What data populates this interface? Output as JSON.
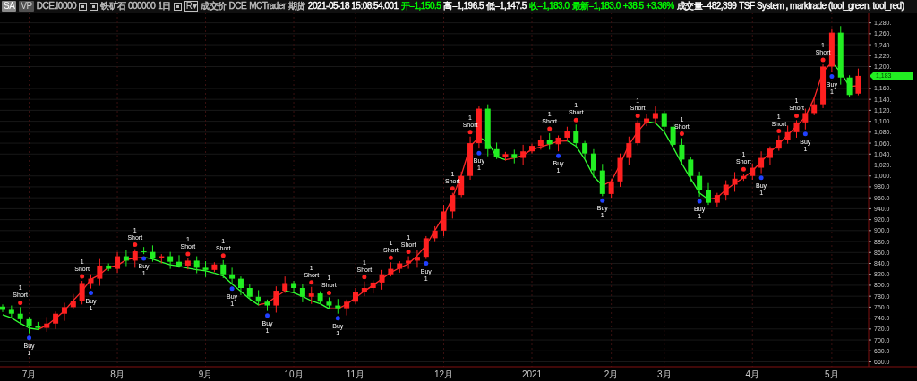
{
  "toolbar": [
    {
      "kind": "badge",
      "text": "SA",
      "selected": true
    },
    {
      "kind": "badge",
      "text": "VP",
      "selected": false
    },
    {
      "kind": "text",
      "text": "DCE.I0000",
      "color": "#c0c0c0"
    },
    {
      "kind": "square"
    },
    {
      "kind": "square"
    },
    {
      "kind": "text",
      "text": "铁矿石 000000",
      "color": "#c0c0c0"
    },
    {
      "kind": "text",
      "text": "1日",
      "color": "#c0c0c0"
    },
    {
      "kind": "square"
    },
    {
      "kind": "box",
      "text": "R▾"
    },
    {
      "kind": "text",
      "text": "成交价",
      "color": "#c0c0c0"
    },
    {
      "kind": "text",
      "text": "DCE",
      "color": "#c0c0c0"
    },
    {
      "kind": "text",
      "text": "MCTrader",
      "color": "#c0c0c0"
    },
    {
      "kind": "text",
      "text": "期货",
      "color": "#c0c0c0"
    },
    {
      "kind": "text",
      "text": "2021-05-18  15:08:54.001",
      "color": "#ffffff"
    },
    {
      "kind": "text",
      "text": "开=1,150.5",
      "color": "#00ff00"
    },
    {
      "kind": "text",
      "text": "高=1,196.5",
      "color": "#ffffff"
    },
    {
      "kind": "text",
      "text": "低=1,147.5",
      "color": "#ffffff"
    },
    {
      "kind": "text",
      "text": "收=1,183.0",
      "color": "#00ff00"
    },
    {
      "kind": "text",
      "text": "最新=1,183.0",
      "color": "#00ff00"
    },
    {
      "kind": "text",
      "text": "+38.5",
      "color": "#00ff00"
    },
    {
      "kind": "text",
      "text": "+3.36%",
      "color": "#00ff00"
    },
    {
      "kind": "text",
      "text": "成交量=482,399",
      "color": "#ffffff"
    },
    {
      "kind": "text",
      "text": "TSF System , marktrade (tool_green,  tool_red)",
      "color": "#ffffff"
    }
  ],
  "chart": {
    "price_tag": "1,183",
    "chart_data": {
      "type": "candlestick",
      "grid": true,
      "ylim": [
        651,
        1299
      ],
      "yticks": [
        {
          "value": 1280,
          "label": "1,280."
        },
        {
          "value": 1260,
          "label": "1,260."
        },
        {
          "value": 1240,
          "label": "1,240."
        },
        {
          "value": 1220,
          "label": "1,220."
        },
        {
          "value": 1200,
          "label": "1,200."
        },
        {
          "value": 1160,
          "label": "1,160."
        },
        {
          "value": 1140,
          "label": "1,140."
        },
        {
          "value": 1120,
          "label": "1,120."
        },
        {
          "value": 1100,
          "label": "1,100."
        },
        {
          "value": 1080,
          "label": "1,080."
        },
        {
          "value": 1060,
          "label": "1,060."
        },
        {
          "value": 1040,
          "label": "1,040."
        },
        {
          "value": 1020,
          "label": "1,020."
        },
        {
          "value": 1000,
          "label": "1,000."
        },
        {
          "value": 980,
          "label": "980.0"
        },
        {
          "value": 960,
          "label": "960.0"
        },
        {
          "value": 940,
          "label": "940.0"
        },
        {
          "value": 920,
          "label": "920.0"
        },
        {
          "value": 900,
          "label": "900.0"
        },
        {
          "value": 880,
          "label": "880.0"
        },
        {
          "value": 860,
          "label": "860.0"
        },
        {
          "value": 840,
          "label": "840.0"
        },
        {
          "value": 820,
          "label": "820.0"
        },
        {
          "value": 800,
          "label": "800.0"
        },
        {
          "value": 780,
          "label": "780.0"
        },
        {
          "value": 760,
          "label": "760.0"
        },
        {
          "value": 740,
          "label": "740.0"
        },
        {
          "value": 720,
          "label": "720.0"
        },
        {
          "value": 700,
          "label": "700.0"
        },
        {
          "value": 680,
          "label": "680.0"
        },
        {
          "value": 660,
          "label": "660.0"
        }
      ],
      "categories": [
        null,
        null,
        null,
        "7月",
        null,
        null,
        null,
        null,
        null,
        null,
        null,
        null,
        null,
        "8月",
        null,
        null,
        null,
        null,
        null,
        null,
        null,
        null,
        null,
        "9月",
        null,
        null,
        null,
        null,
        null,
        null,
        null,
        null,
        null,
        "10月",
        null,
        null,
        null,
        null,
        null,
        null,
        "11月",
        null,
        null,
        null,
        null,
        null,
        null,
        null,
        null,
        null,
        "12月",
        null,
        null,
        null,
        null,
        null,
        null,
        null,
        null,
        null,
        "2021",
        null,
        null,
        null,
        null,
        null,
        null,
        null,
        null,
        "2月",
        null,
        null,
        null,
        null,
        null,
        "3月",
        null,
        null,
        null,
        null,
        null,
        null,
        null,
        null,
        null,
        "4月",
        null,
        null,
        null,
        null,
        null,
        null,
        null,
        null,
        "5月",
        null,
        null,
        null
      ],
      "ohlc": [
        [
          761,
          765,
          751,
          755
        ],
        [
          755,
          763,
          741,
          748
        ],
        [
          748,
          760,
          728,
          738
        ],
        [
          738,
          742,
          712,
          725
        ],
        [
          725,
          733,
          718,
          722
        ],
        [
          722,
          742,
          715,
          730
        ],
        [
          730,
          752,
          720,
          748
        ],
        [
          748,
          768,
          735,
          760
        ],
        [
          760,
          784,
          756,
          772
        ],
        [
          772,
          808,
          765,
          804
        ],
        [
          804,
          820,
          794,
          812
        ],
        [
          812,
          848,
          799,
          836
        ],
        [
          836,
          840,
          826,
          830
        ],
        [
          830,
          861,
          823,
          853
        ],
        [
          853,
          865,
          835,
          845
        ],
        [
          845,
          866,
          832,
          862
        ],
        [
          862,
          870,
          857,
          861
        ],
        [
          861,
          873,
          843,
          850
        ],
        [
          850,
          857,
          840,
          853
        ],
        [
          853,
          861,
          830,
          843
        ],
        [
          843,
          855,
          832,
          836
        ],
        [
          836,
          849,
          829,
          845
        ],
        [
          845,
          853,
          822,
          832
        ],
        [
          832,
          844,
          815,
          828
        ],
        [
          828,
          842,
          824,
          838
        ],
        [
          838,
          846,
          813,
          820
        ],
        [
          820,
          832,
          802,
          812
        ],
        [
          812,
          816,
          782,
          795
        ],
        [
          795,
          803,
          775,
          779
        ],
        [
          779,
          791,
          763,
          770
        ],
        [
          770,
          774,
          753,
          763
        ],
        [
          763,
          798,
          750,
          790
        ],
        [
          790,
          816,
          786,
          804
        ],
        [
          804,
          808,
          788,
          795
        ],
        [
          795,
          803,
          769,
          779
        ],
        [
          779,
          797,
          766,
          785
        ],
        [
          785,
          789,
          766,
          770
        ],
        [
          770,
          778,
          756,
          763
        ],
        [
          763,
          775,
          748,
          758
        ],
        [
          758,
          774,
          745,
          770
        ],
        [
          770,
          795,
          766,
          787
        ],
        [
          787,
          807,
          780,
          795
        ],
        [
          795,
          809,
          785,
          805
        ],
        [
          805,
          828,
          792,
          820
        ],
        [
          820,
          842,
          816,
          830
        ],
        [
          830,
          844,
          823,
          840
        ],
        [
          840,
          853,
          830,
          845
        ],
        [
          845,
          864,
          832,
          852
        ],
        [
          852,
          890,
          848,
          886
        ],
        [
          886,
          908,
          879,
          900
        ],
        [
          900,
          947,
          890,
          935
        ],
        [
          935,
          969,
          922,
          965
        ],
        [
          965,
          1008,
          961,
          1000
        ],
        [
          1000,
          1072,
          993,
          1060
        ],
        [
          1060,
          1127,
          1050,
          1123
        ],
        [
          1123,
          1131,
          1036,
          1049
        ],
        [
          1049,
          1061,
          1031,
          1035
        ],
        [
          1035,
          1044,
          1028,
          1040
        ],
        [
          1040,
          1048,
          1023,
          1033
        ],
        [
          1033,
          1057,
          1020,
          1045
        ],
        [
          1045,
          1059,
          1041,
          1055
        ],
        [
          1055,
          1074,
          1048,
          1066
        ],
        [
          1066,
          1078,
          1048,
          1058
        ],
        [
          1058,
          1074,
          1045,
          1070
        ],
        [
          1070,
          1090,
          1066,
          1082
        ],
        [
          1082,
          1094,
          1053,
          1060
        ],
        [
          1060,
          1064,
          1031,
          1041
        ],
        [
          1041,
          1049,
          997,
          1010
        ],
        [
          1010,
          1022,
          963,
          967
        ],
        [
          967,
          994,
          960,
          990
        ],
        [
          990,
          1041,
          980,
          1033
        ],
        [
          1033,
          1072,
          1020,
          1060
        ],
        [
          1060,
          1102,
          1056,
          1098
        ],
        [
          1098,
          1113,
          1091,
          1105
        ],
        [
          1105,
          1127,
          1095,
          1115
        ],
        [
          1115,
          1119,
          1077,
          1090
        ],
        [
          1090,
          1098,
          1053,
          1057
        ],
        [
          1057,
          1069,
          1023,
          1030
        ],
        [
          1030,
          1034,
          990,
          1000
        ],
        [
          1000,
          1008,
          962,
          975
        ],
        [
          975,
          987,
          947,
          951
        ],
        [
          951,
          969,
          944,
          965
        ],
        [
          965,
          992,
          955,
          984
        ],
        [
          984,
          1007,
          971,
          995
        ],
        [
          995,
          1004,
          991,
          1000
        ],
        [
          1000,
          1023,
          993,
          1015
        ],
        [
          1015,
          1045,
          1005,
          1033
        ],
        [
          1033,
          1054,
          1020,
          1050
        ],
        [
          1050,
          1074,
          1046,
          1066
        ],
        [
          1066,
          1092,
          1059,
          1080
        ],
        [
          1080,
          1102,
          1070,
          1098
        ],
        [
          1098,
          1123,
          1085,
          1115
        ],
        [
          1115,
          1143,
          1111,
          1131
        ],
        [
          1131,
          1204,
          1124,
          1200
        ],
        [
          1200,
          1270,
          1190,
          1262
        ],
        [
          1262,
          1274,
          1167,
          1180
        ],
        [
          1180,
          1184,
          1144,
          1148
        ],
        [
          1150.5,
          1196.5,
          1147.5,
          1183
        ]
      ]
    },
    "signals": [
      {
        "kind": "none"
      },
      {
        "kind": "none"
      },
      {
        "kind": "short",
        "label": "Short",
        "count": "1"
      },
      {
        "kind": "buy",
        "label": "Buy",
        "count": "1"
      },
      {
        "kind": "none"
      },
      {
        "kind": "none"
      },
      {
        "kind": "none"
      },
      {
        "kind": "none"
      },
      {
        "kind": "none"
      },
      {
        "kind": "short",
        "label": "Short",
        "count": "1"
      },
      {
        "kind": "buy",
        "label": "Buy",
        "count": "1"
      },
      {
        "kind": "none"
      },
      {
        "kind": "none"
      },
      {
        "kind": "none"
      },
      {
        "kind": "none"
      },
      {
        "kind": "short",
        "label": "Short",
        "count": "1"
      },
      {
        "kind": "buy",
        "label": "Buy",
        "count": "1"
      },
      {
        "kind": "none"
      },
      {
        "kind": "none"
      },
      {
        "kind": "none"
      },
      {
        "kind": "none"
      },
      {
        "kind": "short",
        "label": "Short",
        "count": "1"
      },
      {
        "kind": "none"
      },
      {
        "kind": "none"
      },
      {
        "kind": "none"
      },
      {
        "kind": "short",
        "label": "Short",
        "count": "1"
      },
      {
        "kind": "buy",
        "label": "Buy",
        "count": "1"
      },
      {
        "kind": "none"
      },
      {
        "kind": "none"
      },
      {
        "kind": "none"
      },
      {
        "kind": "buy",
        "label": "Buy",
        "count": "1"
      },
      {
        "kind": "none"
      },
      {
        "kind": "none"
      },
      {
        "kind": "none"
      },
      {
        "kind": "none"
      },
      {
        "kind": "short",
        "label": "Short",
        "count": "1"
      },
      {
        "kind": "none"
      },
      {
        "kind": "short",
        "label": "Short",
        "count": "1"
      },
      {
        "kind": "buy",
        "label": "Buy",
        "count": "1"
      },
      {
        "kind": "none"
      },
      {
        "kind": "none"
      },
      {
        "kind": "short",
        "label": "Short",
        "count": "1"
      },
      {
        "kind": "none"
      },
      {
        "kind": "none"
      },
      {
        "kind": "short",
        "label": "Short",
        "count": "1"
      },
      {
        "kind": "none"
      },
      {
        "kind": "short",
        "label": "Short",
        "count": "1"
      },
      {
        "kind": "none"
      },
      {
        "kind": "buy",
        "label": "Buy",
        "count": "1"
      },
      {
        "kind": "none"
      },
      {
        "kind": "none"
      },
      {
        "kind": "short",
        "label": "Short",
        "count": "1"
      },
      {
        "kind": "none"
      },
      {
        "kind": "short",
        "label": "Short",
        "count": "1"
      },
      {
        "kind": "buy",
        "label": "Buy",
        "count": "1"
      },
      {
        "kind": "none"
      },
      {
        "kind": "none"
      },
      {
        "kind": "none"
      },
      {
        "kind": "none"
      },
      {
        "kind": "none"
      },
      {
        "kind": "none"
      },
      {
        "kind": "none"
      },
      {
        "kind": "short",
        "label": "Short",
        "count": "1"
      },
      {
        "kind": "buy",
        "label": "Buy",
        "count": "1"
      },
      {
        "kind": "none"
      },
      {
        "kind": "short",
        "label": "Short",
        "count": "1"
      },
      {
        "kind": "none"
      },
      {
        "kind": "none"
      },
      {
        "kind": "buy",
        "label": "Buy",
        "count": "1"
      },
      {
        "kind": "none"
      },
      {
        "kind": "none"
      },
      {
        "kind": "none"
      },
      {
        "kind": "short",
        "label": "Short",
        "count": "1"
      },
      {
        "kind": "none"
      },
      {
        "kind": "none"
      },
      {
        "kind": "none"
      },
      {
        "kind": "none"
      },
      {
        "kind": "short",
        "label": "Short",
        "count": "1"
      },
      {
        "kind": "none"
      },
      {
        "kind": "buy",
        "label": "Buy",
        "count": "1"
      },
      {
        "kind": "none"
      },
      {
        "kind": "none"
      },
      {
        "kind": "none"
      },
      {
        "kind": "none"
      },
      {
        "kind": "short",
        "label": "Short",
        "count": "1"
      },
      {
        "kind": "none"
      },
      {
        "kind": "buy",
        "label": "Buy",
        "count": "1"
      },
      {
        "kind": "none"
      },
      {
        "kind": "short",
        "label": "Short",
        "count": "1"
      },
      {
        "kind": "none"
      },
      {
        "kind": "short",
        "label": "Short",
        "count": "1"
      },
      {
        "kind": "buy",
        "label": "Buy",
        "count": "1"
      },
      {
        "kind": "none"
      },
      {
        "kind": "short",
        "label": "Short",
        "count": "1"
      },
      {
        "kind": "buy",
        "label": "Buy",
        "count": "1"
      },
      {
        "kind": "none"
      },
      {
        "kind": "none"
      },
      {
        "kind": "none"
      }
    ]
  }
}
